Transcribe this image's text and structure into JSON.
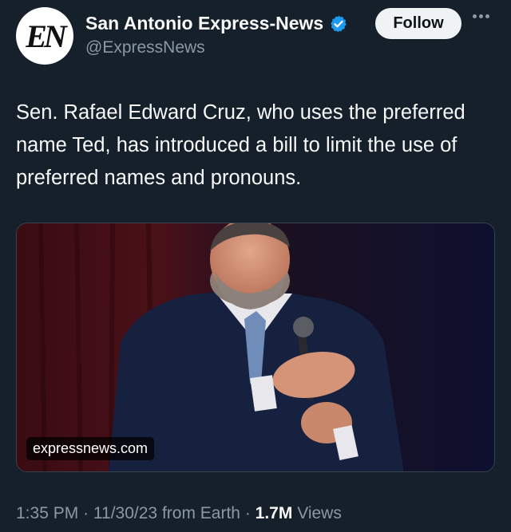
{
  "account": {
    "avatar_text": "EN",
    "name": "San Antonio Express-News",
    "handle": "@ExpressNews",
    "verified_icon": "verified-badge-icon"
  },
  "actions": {
    "follow_label": "Follow",
    "more_icon": "more-options-icon"
  },
  "tweet": {
    "text": "Sen. Rafael Edward Cruz, who uses the preferred name Ted, has introduced a bill to limit the use of preferred names and pronouns.",
    "media": {
      "domain": "expressnews.com"
    }
  },
  "meta": {
    "time": "1:35 PM",
    "separator": "·",
    "date": "11/30/23",
    "source": "from Earth",
    "views_count": "1.7M",
    "views_label": "Views"
  },
  "colors": {
    "background": "#15202b",
    "primary_text": "#f7f9f9",
    "secondary_text": "#8b98a5",
    "verified_blue": "#1d9bf0"
  }
}
